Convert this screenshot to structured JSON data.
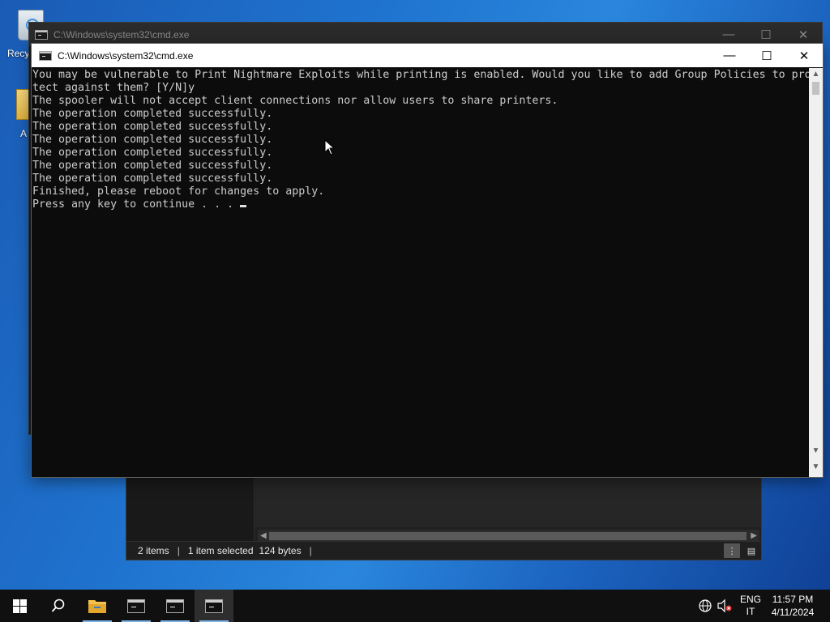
{
  "desktop": {
    "recycle_label": "Recy",
    "second_icon_label": "A"
  },
  "back_window": {
    "title": "C:\\Windows\\system32\\cmd.exe",
    "controls": {
      "minimize": "—",
      "maximize": "☐",
      "close": "✕"
    }
  },
  "front_window": {
    "title": "C:\\Windows\\system32\\cmd.exe",
    "controls": {
      "minimize": "—",
      "maximize": "☐",
      "close": "✕"
    },
    "console_lines": [
      "You may be vulnerable to Print Nightmare Exploits while printing is enabled. Would you like to add Group Policies to pro",
      "tect against them? [Y/N]y",
      "The spooler will not accept client connections nor allow users to share printers.",
      "The operation completed successfully.",
      "The operation completed successfully.",
      "The operation completed successfully.",
      "The operation completed successfully.",
      "The operation completed successfully.",
      "The operation completed successfully.",
      "Finished, please reboot for changes to apply.",
      "Press any key to continue . . . "
    ],
    "colors": {
      "console_bg": "#0c0c0c",
      "console_fg": "#cccccc"
    }
  },
  "explorer": {
    "status_items": "2 items",
    "status_selected": "1 item selected",
    "status_size": "124 bytes",
    "separator": "|"
  },
  "taskbar": {
    "items": [
      "start-icon",
      "search-icon",
      "file-explorer-icon",
      "cmd-icon",
      "cmd-icon",
      "cmd-icon"
    ],
    "language_line1": "ENG",
    "language_line2": "IT",
    "time": "11:57 PM",
    "date": "4/11/2024",
    "accent": "#7fb2e8"
  }
}
